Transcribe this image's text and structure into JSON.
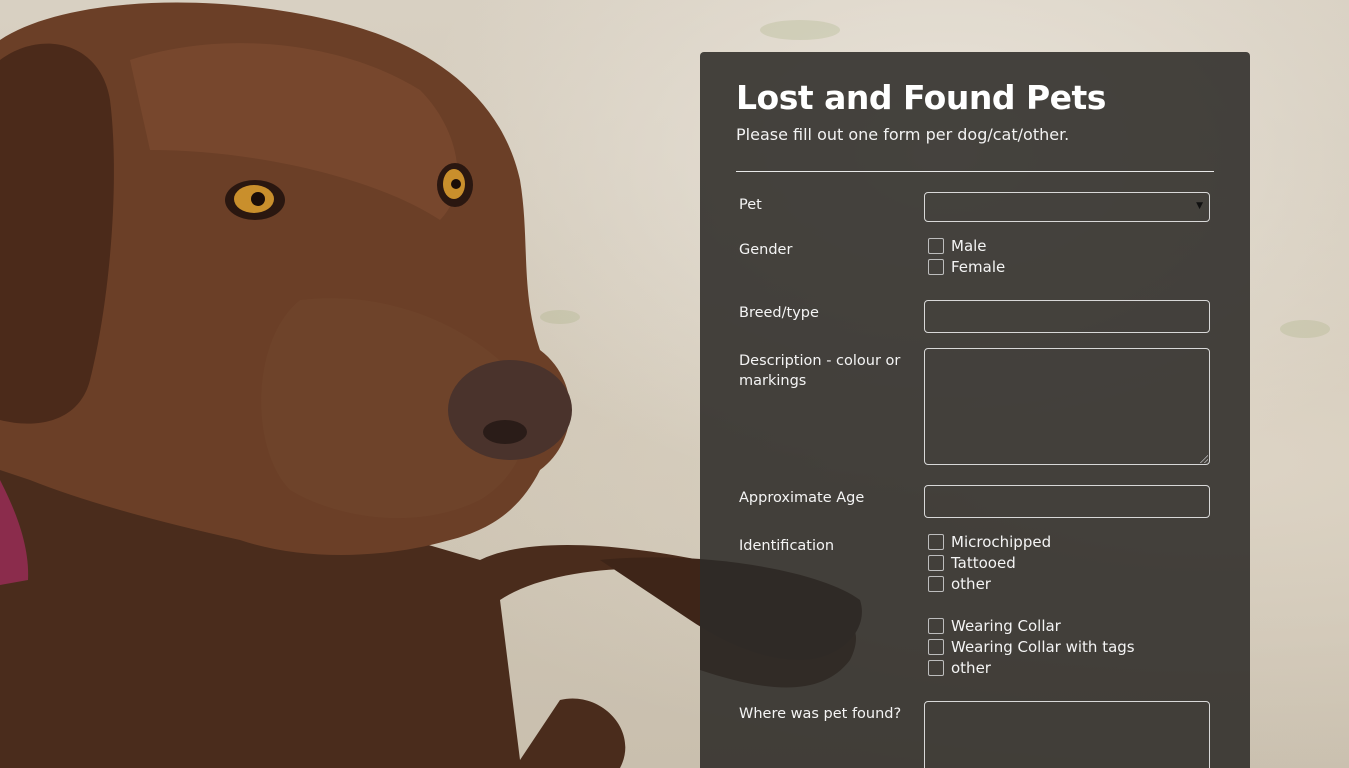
{
  "form": {
    "title": "Lost and Found Pets",
    "subtitle": "Please fill out one form per dog/cat/other.",
    "fields": {
      "pet": {
        "label": "Pet",
        "value": ""
      },
      "gender": {
        "label": "Gender",
        "options": [
          "Male",
          "Female"
        ]
      },
      "breed": {
        "label": "Breed/type",
        "value": ""
      },
      "description": {
        "label": "Description - colour or markings",
        "value": ""
      },
      "age": {
        "label": "Approximate Age",
        "value": ""
      },
      "identification": {
        "label": "Identification",
        "options": [
          "Microchipped",
          "Tattooed",
          "other"
        ],
        "collar_options": [
          "Wearing Collar",
          "Wearing Collar with tags",
          "other"
        ]
      },
      "where_found": {
        "label": "Where was pet found?",
        "value": ""
      }
    }
  },
  "colors": {
    "panel": "#2d2b28",
    "text": "#ffffff",
    "field_border": "#d8d8d8"
  },
  "icons": {
    "select_arrow": "chevron-down-icon"
  }
}
